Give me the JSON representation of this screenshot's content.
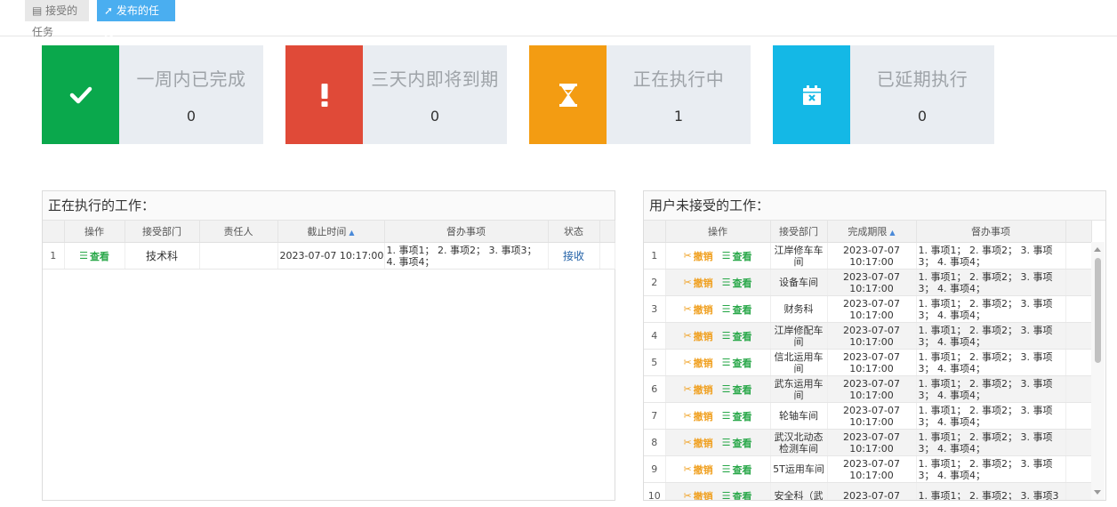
{
  "toolbar": {
    "received_tab": "接受的任务",
    "published_tab": "发布的任务"
  },
  "cards": [
    {
      "title": "一周内已完成",
      "count": "0",
      "color": "#0aa84c",
      "icon": "check-icon"
    },
    {
      "title": "三天内即将到期",
      "count": "0",
      "color": "#e04a38",
      "icon": "exclamation-icon"
    },
    {
      "title": "正在执行中",
      "count": "1",
      "color": "#f39c12",
      "icon": "hourglass-icon"
    },
    {
      "title": "已延期执行",
      "count": "0",
      "color": "#14b8e6",
      "icon": "calendar-x-icon"
    }
  ],
  "executing": {
    "title": "正在执行的工作：",
    "headers": [
      "操作",
      "接受部门",
      "责任人",
      "截止时间",
      "督办事项",
      "状态"
    ],
    "rows": [
      {
        "num": "1",
        "view": "查看",
        "dept": "技术科",
        "person": "",
        "deadline": "2023-07-07 10:17:00",
        "items": "1. 事项1； 2. 事项2； 3. 事项3； 4. 事项4；",
        "status": "接收"
      }
    ]
  },
  "unaccepted": {
    "title": "用户未接受的工作：",
    "headers": [
      "操作",
      "接受部门",
      "完成期限",
      "督办事项"
    ],
    "cancel_label": "撤销",
    "view_label": "查看",
    "rows": [
      {
        "num": "1",
        "dept": "江岸修车车间",
        "date": "2023-07-07",
        "time": "10:17:00",
        "items": "1. 事项1； 2. 事项2； 3. 事项3； 4. 事项4；"
      },
      {
        "num": "2",
        "dept": "设备车间",
        "date": "2023-07-07",
        "time": "10:17:00",
        "items": "1. 事项1； 2. 事项2； 3. 事项3； 4. 事项4；"
      },
      {
        "num": "3",
        "dept": "财务科",
        "date": "2023-07-07",
        "time": "10:17:00",
        "items": "1. 事项1； 2. 事项2； 3. 事项3； 4. 事项4；"
      },
      {
        "num": "4",
        "dept": "江岸修配车间",
        "date": "2023-07-07",
        "time": "10:17:00",
        "items": "1. 事项1； 2. 事项2； 3. 事项3； 4. 事项4；"
      },
      {
        "num": "5",
        "dept": "信北运用车间",
        "date": "2023-07-07",
        "time": "10:17:00",
        "items": "1. 事项1； 2. 事项2； 3. 事项3； 4. 事项4；"
      },
      {
        "num": "6",
        "dept": "武东运用车间",
        "date": "2023-07-07",
        "time": "10:17:00",
        "items": "1. 事项1； 2. 事项2； 3. 事项3； 4. 事项4；"
      },
      {
        "num": "7",
        "dept": "轮轴车间",
        "date": "2023-07-07",
        "time": "10:17:00",
        "items": "1. 事项1； 2. 事项2； 3. 事项3； 4. 事项4；"
      },
      {
        "num": "8",
        "dept": "武汉北动态检测车间",
        "date": "2023-07-07",
        "time": "10:17:00",
        "items": "1. 事项1； 2. 事项2； 3. 事项3； 4. 事项4；"
      },
      {
        "num": "9",
        "dept": "5T运用车间",
        "date": "2023-07-07",
        "time": "10:17:00",
        "items": "1. 事项1； 2. 事项2； 3. 事项3； 4. 事项4；"
      },
      {
        "num": "10",
        "dept": "安全科（武",
        "date": "2023-07-07",
        "time": "",
        "items": "1. 事项1； 2. 事项2； 3. 事项3"
      }
    ]
  }
}
